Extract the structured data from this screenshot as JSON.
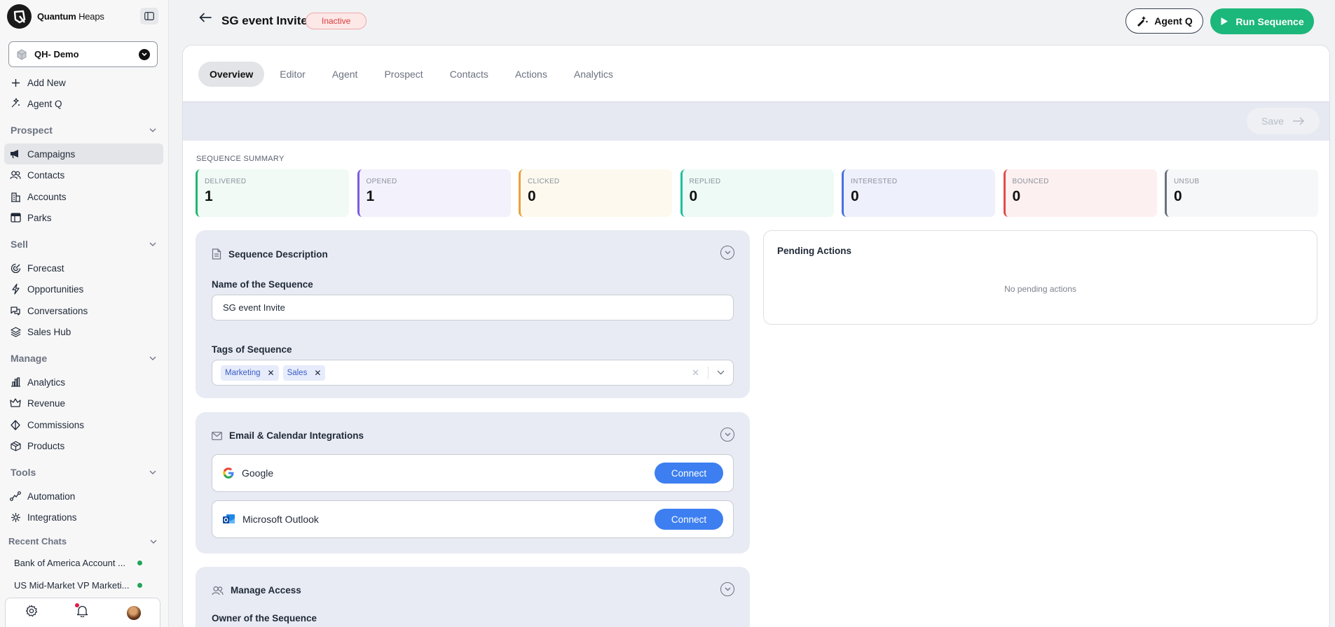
{
  "brand": {
    "name_bold": "Quantum",
    "name_light": " Heaps"
  },
  "org": {
    "name": "QH- Demo"
  },
  "top_actions": [
    {
      "label": "Add New",
      "icon": "plus-icon"
    },
    {
      "label": "Agent Q",
      "icon": "sparkle-icon"
    }
  ],
  "sections": {
    "prospect": "Prospect",
    "sell": "Sell",
    "manage": "Manage",
    "tools": "Tools",
    "recent": "Recent Chats"
  },
  "nav": {
    "campaigns": "Campaigns",
    "contacts": "Contacts",
    "accounts": "Accounts",
    "parks": "Parks",
    "forecast": "Forecast",
    "opportunities": "Opportunities",
    "conversations": "Conversations",
    "sales_hub": "Sales Hub",
    "analytics": "Analytics",
    "revenue": "Revenue",
    "commissions": "Commissions",
    "products": "Products",
    "automation": "Automation",
    "integrations": "Integrations"
  },
  "recent_chats": [
    {
      "title": "Bank of America Account ..."
    },
    {
      "title": "US Mid-Market VP Marketi..."
    }
  ],
  "header": {
    "title": "SG event Invite",
    "status": "Inactive",
    "agent_q_label": "Agent Q",
    "run_label": "Run Sequence"
  },
  "tabs": [
    "Overview",
    "Editor",
    "Agent",
    "Prospect",
    "Contacts",
    "Actions",
    "Analytics"
  ],
  "save_label": "Save",
  "summary": {
    "label": "SEQUENCE SUMMARY",
    "stats": [
      {
        "label": "DELIVERED",
        "value": "1",
        "color": "#22b573",
        "bg": "#f1faf5"
      },
      {
        "label": "OPENED",
        "value": "1",
        "color": "#7c5ce0",
        "bg": "#f3f1fc"
      },
      {
        "label": "CLICKED",
        "value": "0",
        "color": "#e9a23b",
        "bg": "#fdf9ee"
      },
      {
        "label": "REPLIED",
        "value": "0",
        "color": "#1fbf9a",
        "bg": "#eefaf6"
      },
      {
        "label": "INTERESTED",
        "value": "0",
        "color": "#4a6fe0",
        "bg": "#eef1fb"
      },
      {
        "label": "BOUNCED",
        "value": "0",
        "color": "#e04b4b",
        "bg": "#fdf0f0"
      },
      {
        "label": "UNSUB",
        "value": "0",
        "color": "#6b7280",
        "bg": "#f6f7f8"
      }
    ]
  },
  "description_card": {
    "title": "Sequence Description",
    "name_label": "Name of the Sequence",
    "name_value": "SG event Invite",
    "tags_label": "Tags of Sequence",
    "tags": [
      "Marketing",
      "Sales"
    ]
  },
  "integrations_card": {
    "title": "Email & Calendar Integrations",
    "items": [
      {
        "name": "Google",
        "action": "Connect"
      },
      {
        "name": "Microsoft Outlook",
        "action": "Connect"
      }
    ]
  },
  "access_card": {
    "title": "Manage Access",
    "owner_label": "Owner of the Sequence"
  },
  "pending": {
    "title": "Pending Actions",
    "empty": "No pending actions"
  }
}
